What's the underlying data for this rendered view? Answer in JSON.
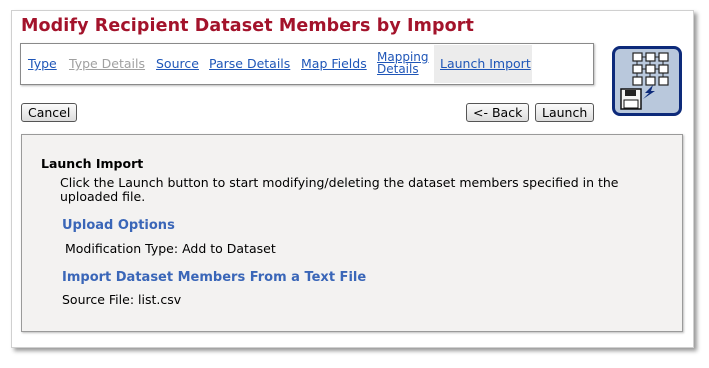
{
  "page": {
    "title": "Modify Recipient Dataset Members by Import"
  },
  "tabs": [
    {
      "label": "Type",
      "state": "link"
    },
    {
      "label": "Type Details",
      "state": "disabled"
    },
    {
      "label": "Source",
      "state": "link"
    },
    {
      "label": "Parse Details",
      "state": "link"
    },
    {
      "label": "Map Fields",
      "state": "link"
    },
    {
      "label": "Mapping Details",
      "line1": "Mapping",
      "line2": "Details",
      "state": "link"
    },
    {
      "label": "Launch Import",
      "state": "active"
    }
  ],
  "icon": {
    "name": "import-dataset-icon"
  },
  "toolbar": {
    "cancel_label": "Cancel",
    "back_label": "<- Back",
    "launch_label": "Launch"
  },
  "launch": {
    "heading": "Launch Import",
    "description": "Click the Launch button to start modifying/deleting the dataset members specified in the uploaded file."
  },
  "upload_options": {
    "heading": "Upload Options",
    "modification_type_label": "Modification Type:",
    "modification_type_value": "Add to Dataset"
  },
  "import_source": {
    "heading": "Import Dataset Members From a Text File",
    "source_file_label": "Source File:",
    "source_file_value": "list.csv"
  },
  "colors": {
    "title": "#a3132b",
    "link": "#1f56b8",
    "sub_heading": "#3a66b8",
    "icon_border": "#0d2a7a"
  }
}
